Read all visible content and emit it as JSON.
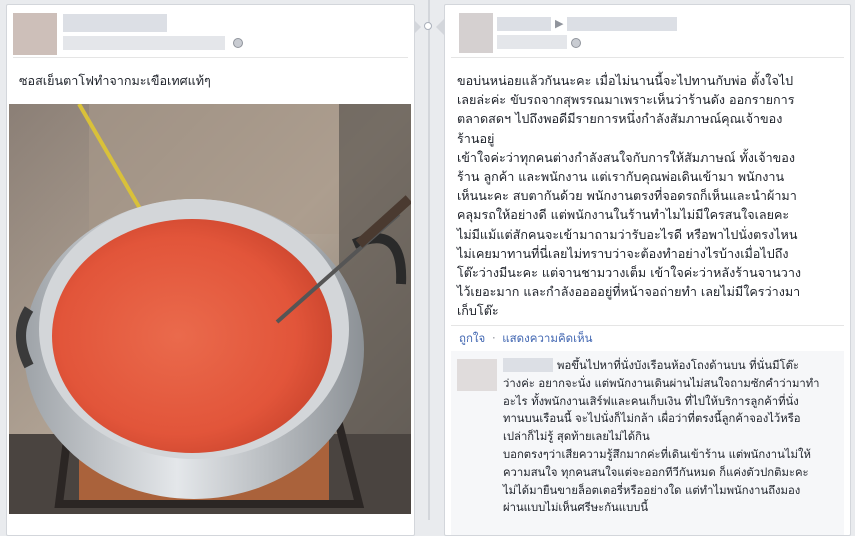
{
  "left_post": {
    "caption": "ซอสเย็นตาโฟทำจากมะเขือเทศแท้ๆ"
  },
  "right_post": {
    "body": "ขอบ่นหน่อยแล้วกันนะคะ เมื่อไม่นานนี้จะไปทานกับพ่อ ตั้งใจไป\nเลยล่ะค่ะ ขับรถจากสุพรรณมาเพราะเห็นว่าร้านดัง ออกรายการ\nตลาดสดฯ ไปถึงพอดีมีรายการหนึ่งกำลังสัมภาษณ์คุณเจ้าของ\nร้านอยู่\nเข้าใจค่ะว่าทุกคนต่างกำลังสนใจกับการให้สัมภาษณ์ ทั้งเจ้าของ\nร้าน ลูกค้า และพนักงาน แต่เรากับคุณพ่อเดินเข้ามา พนักงาน\nเห็นนะคะ สบตากันด้วย พนักงานตรงที่จอดรถก็เห็นและนำผ้ามา\nคลุมรถให้อย่างดี แต่พนักงานในร้านทำไมไม่มีใครสนใจเลยคะ\nไม่มีแม้แต่สักคนจะเข้ามาถามว่ารับอะไรดี หรือพาไปนั่งตรงไหน\nไม่เคยมาทานที่นี่เลยไม่ทราบว่าจะต้องทำอย่างไรบ้างเมื่อไปถึง\nโต๊ะว่างมีนะคะ แต่จานชามวางเต็ม เข้าใจค่ะว่าหลังร้านจานวาง\nไว้เยอะมาก และกำลังออออยู่ที่หน้าจอถ่ายทำ เลยไม่มีใครว่างมา\nเก็บโต๊ะ",
    "like_label": "ถูกใจ",
    "dot": "·",
    "comment_label": "แสดงความคิดเห็น"
  },
  "comment": {
    "body": "พอขึ้นไปหาที่นั่งบังเรือนห้องโถงด้านบน ที่นั่นมีโต๊ะ\nว่างค่ะ อยากจะนั่ง แต่พนักงานเดินผ่านไม่สนใจถามซักคำว่ามาทำ\nอะไร ทั้งพนักงานเสิร์ฟและคนเก็บเงิน ที่ไปให้บริการลูกค้าที่นั่ง\nทานบนเรือนนี้ จะไปนั่งก็ไม่กล้า เผื่อว่าที่ตรงนี้ลูกค้าจองไว้หรือ\nเปล่าก็ไม่รู้ สุดท้ายเลยไม่ได้กิน\nบอกตรงๆว่าเสียความรู้สึกมากค่ะที่เดินเข้าร้าน แต่พนักงานไม่ให้\nความสนใจ ทุกคนสนใจแต่จะออกทีวีกันหมด ก็แค่งตัวปกติมะคะ\nไม่ได้มายืนขายล็อตเตอรี่หรืออย่างใด แต่ทำไมพนักงานถึงมอง\nผ่านแบบไม่เห็นศรีษะกันแบบนี้"
  },
  "colors": {
    "page_bg": "#e9ebee",
    "card_border": "#d3d6db",
    "link": "#4267b2",
    "text": "#1d2129",
    "sauce": "#e2553a"
  },
  "icons": [
    "globe-icon",
    "globe-icon"
  ]
}
